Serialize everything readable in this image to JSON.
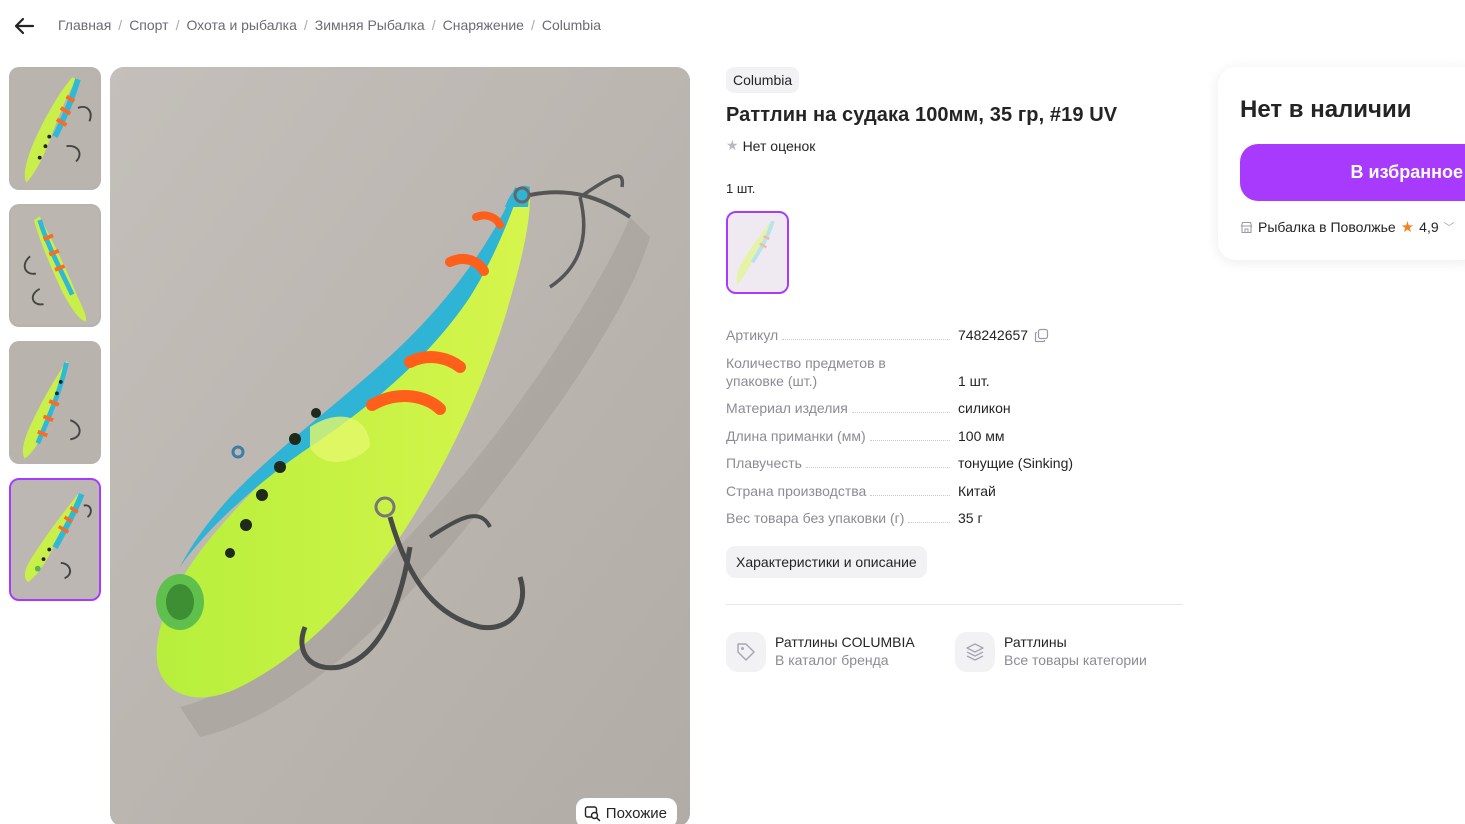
{
  "breadcrumb": {
    "items": [
      "Главная",
      "Спорт",
      "Охота и рыбалка",
      "Зимняя Рыбалка",
      "Снаряжение",
      "Columbia"
    ],
    "separator": "/"
  },
  "icons": {
    "back": "arrow-left-icon",
    "similar": "image-search-icon",
    "copy": "copy-icon",
    "tag": "tag-icon",
    "layers": "layers-icon",
    "shop": "shop-icon",
    "star": "star-icon"
  },
  "gallery": {
    "thumbnail_count": 4,
    "active_thumbnail": 4,
    "similar_label": "Похожие"
  },
  "product": {
    "brand": "Columbia",
    "title": "Раттлин на судака 100мм, 35 гр, #19 UV",
    "rating_text": "Нет оценок",
    "variant_label": "1 шт.",
    "specs": [
      {
        "key": "Артикул",
        "value": "748242657"
      },
      {
        "key": "Количество предметов в упаковке (шт.)",
        "value": "1 шт."
      },
      {
        "key": "Материал изделия",
        "value": "силикон"
      },
      {
        "key": "Длина приманки (мм)",
        "value": "100 мм"
      },
      {
        "key": "Плавучесть",
        "value": "тонущие (Sinking)"
      },
      {
        "key": "Страна производства",
        "value": "Китай"
      },
      {
        "key": "Вес товара без упаковки (г)",
        "value": "35 г"
      }
    ],
    "description_button": "Характеристики и описание",
    "links": [
      {
        "title": "Раттлины COLUMBIA",
        "subtitle": "В каталог бренда"
      },
      {
        "title": "Раттлины",
        "subtitle": "Все товары категории"
      }
    ]
  },
  "buy_panel": {
    "status": "Нет в наличии",
    "favorite_button": "В избранное",
    "seller_name": "Рыбалка в Поволжье",
    "seller_rating": "4,9"
  },
  "colors": {
    "accent": "#a73afd",
    "rating_star": "#f5821f",
    "muted_text": "#8b8b96",
    "chip_bg": "#f2f2f5"
  }
}
